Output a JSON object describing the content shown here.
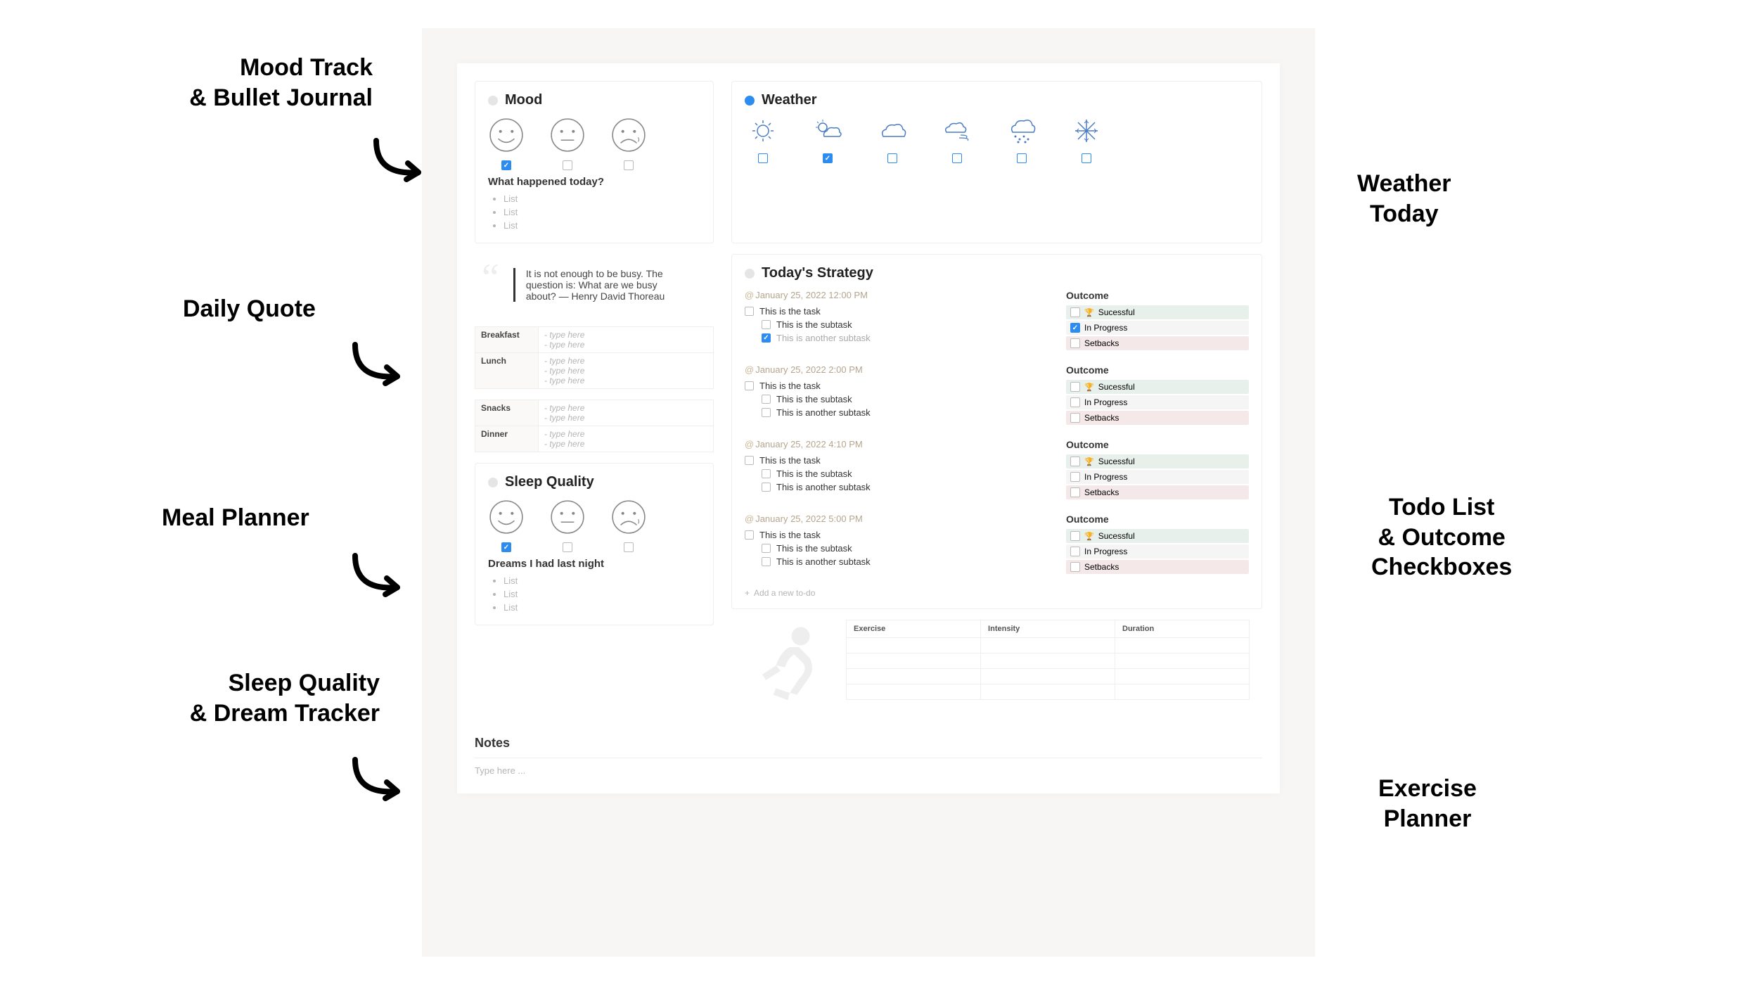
{
  "annotations": {
    "mood": "Mood Track\n& Bullet Journal",
    "quote": "Daily Quote",
    "meal": "Meal Planner",
    "sleep": "Sleep Quality\n& Dream Tracker",
    "weather": "Weather\nToday",
    "todo": "Todo List\n& Outcome\nCheckboxes",
    "exercise": "Exercise\nPlanner"
  },
  "mood": {
    "title": "Mood",
    "happened_title": "What happened today?",
    "list": [
      "List",
      "List",
      "List"
    ]
  },
  "weather": {
    "title": "Weather"
  },
  "quote": {
    "text": "It is not enough to be busy. The question is: What are we busy about? — Henry David Thoreau"
  },
  "meals": {
    "breakfast_label": "Breakfast",
    "lunch_label": "Lunch",
    "snacks_label": "Snacks",
    "dinner_label": "Dinner",
    "placeholder": "- type here"
  },
  "sleep": {
    "title": "Sleep Quality",
    "dreams_title": "Dreams I had last night",
    "list": [
      "List",
      "List",
      "List"
    ]
  },
  "strategy": {
    "title": "Today's Strategy",
    "blocks": [
      {
        "time": "January 25, 2022 12:00 PM",
        "task": "This is the task",
        "sub1": "This is the subtask",
        "sub2": "This is another subtask"
      },
      {
        "time": "January 25, 2022 2:00 PM",
        "task": "This is the task",
        "sub1": "This is the subtask",
        "sub2": "This is another subtask"
      },
      {
        "time": "January 25, 2022 4:10 PM",
        "task": "This is the task",
        "sub1": "This is the subtask",
        "sub2": "This is another subtask"
      },
      {
        "time": "January 25, 2022 5:00 PM",
        "task": "This is the task",
        "sub1": "This is the subtask",
        "sub2": "This is another subtask"
      }
    ],
    "outcome_title": "Outcome",
    "outcome_success": "Sucessful",
    "outcome_progress": "In Progress",
    "outcome_setbacks": "Setbacks",
    "add_todo": "Add a new to-do"
  },
  "exercise": {
    "col1": "Exercise",
    "col2": "Intensity",
    "col3": "Duration"
  },
  "notes": {
    "title": "Notes",
    "placeholder": "Type here ..."
  }
}
